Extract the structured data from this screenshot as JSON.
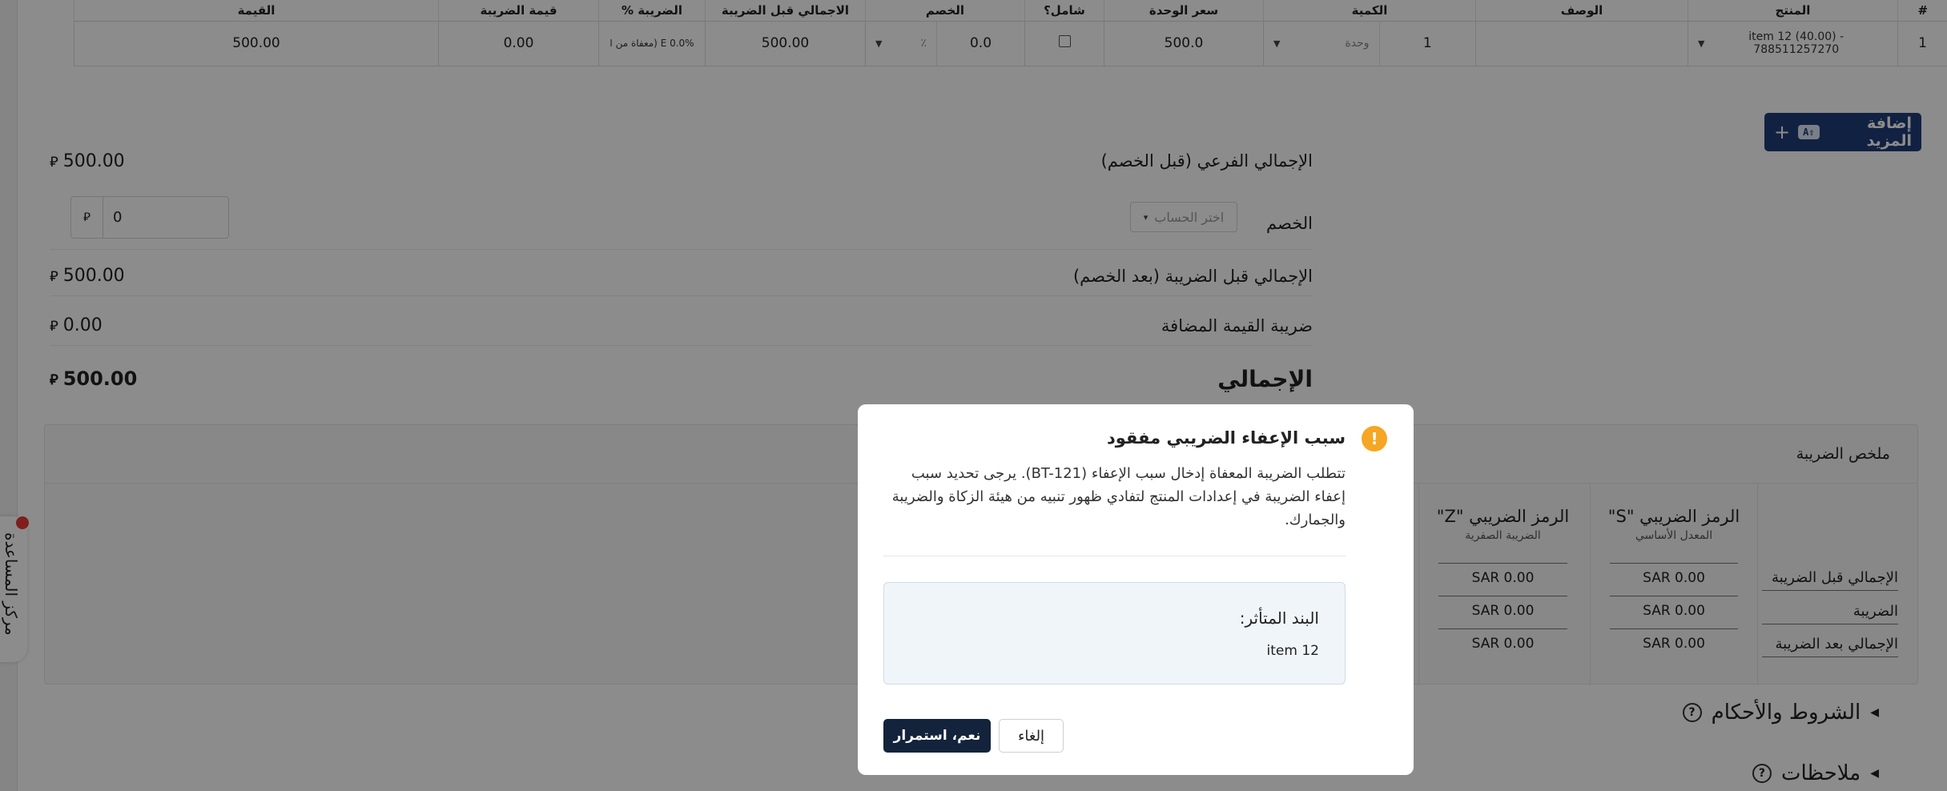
{
  "table": {
    "headers": [
      "#",
      "المنتج",
      "الوصف",
      "الكمية",
      "سعر الوحدة",
      "شامل؟",
      "الخصم",
      "الاجمالي قبل الضريبة",
      "الضريبة %",
      "قيمة الضريبة",
      "القيمة"
    ],
    "row": {
      "index": "1",
      "product": "item 12 (40.00) - 788511257270",
      "description": "",
      "quantity": "1",
      "unit": "وحدة",
      "unit_price": "500.0",
      "discount": "0.0",
      "discount_unit": "٪",
      "before_tax": "500.00",
      "tax_rate": "E 0.0% (معفاة من ا",
      "tax_value": "0.00",
      "value": "500.00"
    }
  },
  "add_more": {
    "label": "إضافة المزيد",
    "shortcut": "A"
  },
  "summary": {
    "subtotal_label": "الإجمالي الفرعي (قبل الخصم)",
    "subtotal_value": "500.00",
    "discount_label": "الخصم",
    "discount_value": "0",
    "account_placeholder": "اختر الحساب",
    "before_tax_label": "الإجمالي قبل الضريبة (بعد الخصم)",
    "before_tax_value": "500.00",
    "vat_label": "ضريبة القيمة المضافة",
    "vat_value": "0.00",
    "total_label": "الإجمالي",
    "total_value": "500.00",
    "currency_symbol": "⃁"
  },
  "tax_summary": {
    "title": "ملخص الضريبة",
    "row_labels": [
      "الإجمالي قبل الضريبة",
      "الضريبة",
      "الإجمالي بعد الضريبة"
    ],
    "columns": [
      {
        "head": "الرمز الضريبي \"S\"",
        "sub": "المعدل الأساسي",
        "values": [
          "SAR 0.00",
          "SAR 0.00",
          "SAR 0.00"
        ]
      },
      {
        "head": "الرمز الضريبي \"Z\"",
        "sub": "الضريبة الصفرية",
        "values": [
          "SAR 0.00",
          "SAR 0.00",
          "SAR 0.00"
        ]
      }
    ]
  },
  "sections": {
    "terms": "الشروط والأحكام",
    "notes": "ملاحظات"
  },
  "help_center": {
    "label": "مركز المساعدة"
  },
  "modal": {
    "title": "سبب الإعفاء الضريبي مفقود",
    "body": "تتطلب الضريبة المعفاة إدخال سبب الإعفاء (BT-121). يرجى تحديد سبب إعفاء الضريبة في إعدادات المنتج لتفادي ظهور تنبيه من هيئة الزكاة والضريبة والجمارك.",
    "affected_label": "البند المتأثر:",
    "affected_item": "item 12",
    "continue_label": "نعم، استمرار",
    "cancel_label": "إلغاء"
  }
}
